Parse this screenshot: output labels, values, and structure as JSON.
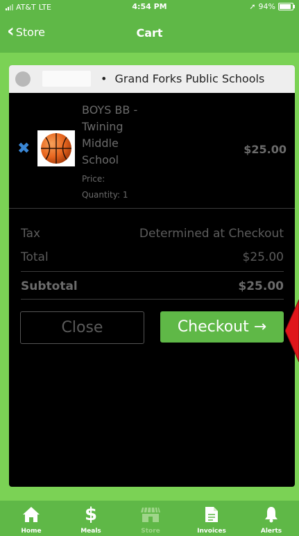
{
  "status_bar": {
    "carrier": "AT&T",
    "network": "LTE",
    "time": "4:54 PM",
    "battery": "94%",
    "battery_level": 0.94
  },
  "nav": {
    "back_label": "Store",
    "title": "Cart"
  },
  "header": {
    "bullet": "•",
    "district": "Grand Forks Public Schools"
  },
  "item": {
    "name_lines": [
      "BOYS BB -",
      "Twining",
      "Middle",
      "School"
    ],
    "price_label": "Price:",
    "quantity_label": "Quantity: 1",
    "amount": "$25.00",
    "remove_icon": "close-x-icon",
    "image_icon": "basketball-icon"
  },
  "totals": {
    "tax_label": "Tax",
    "tax_value": "Determined at Checkout",
    "total_label": "Total",
    "total_value": "$25.00",
    "subtotal_label": "Subtotal",
    "subtotal_value": "$25.00"
  },
  "buttons": {
    "close": "Close",
    "checkout": "Checkout →"
  },
  "tabs": [
    {
      "label": "Home",
      "icon": "home-icon"
    },
    {
      "label": "Meals",
      "icon": "dollar-icon"
    },
    {
      "label": "Store",
      "icon": "store-icon"
    },
    {
      "label": "Invoices",
      "icon": "document-icon"
    },
    {
      "label": "Alerts",
      "icon": "bell-icon"
    }
  ],
  "colors": {
    "brand_green": "#5fb847",
    "background_green": "#7bd255",
    "remove_blue": "#3a87d6",
    "annotation_red": "#e0161b"
  }
}
